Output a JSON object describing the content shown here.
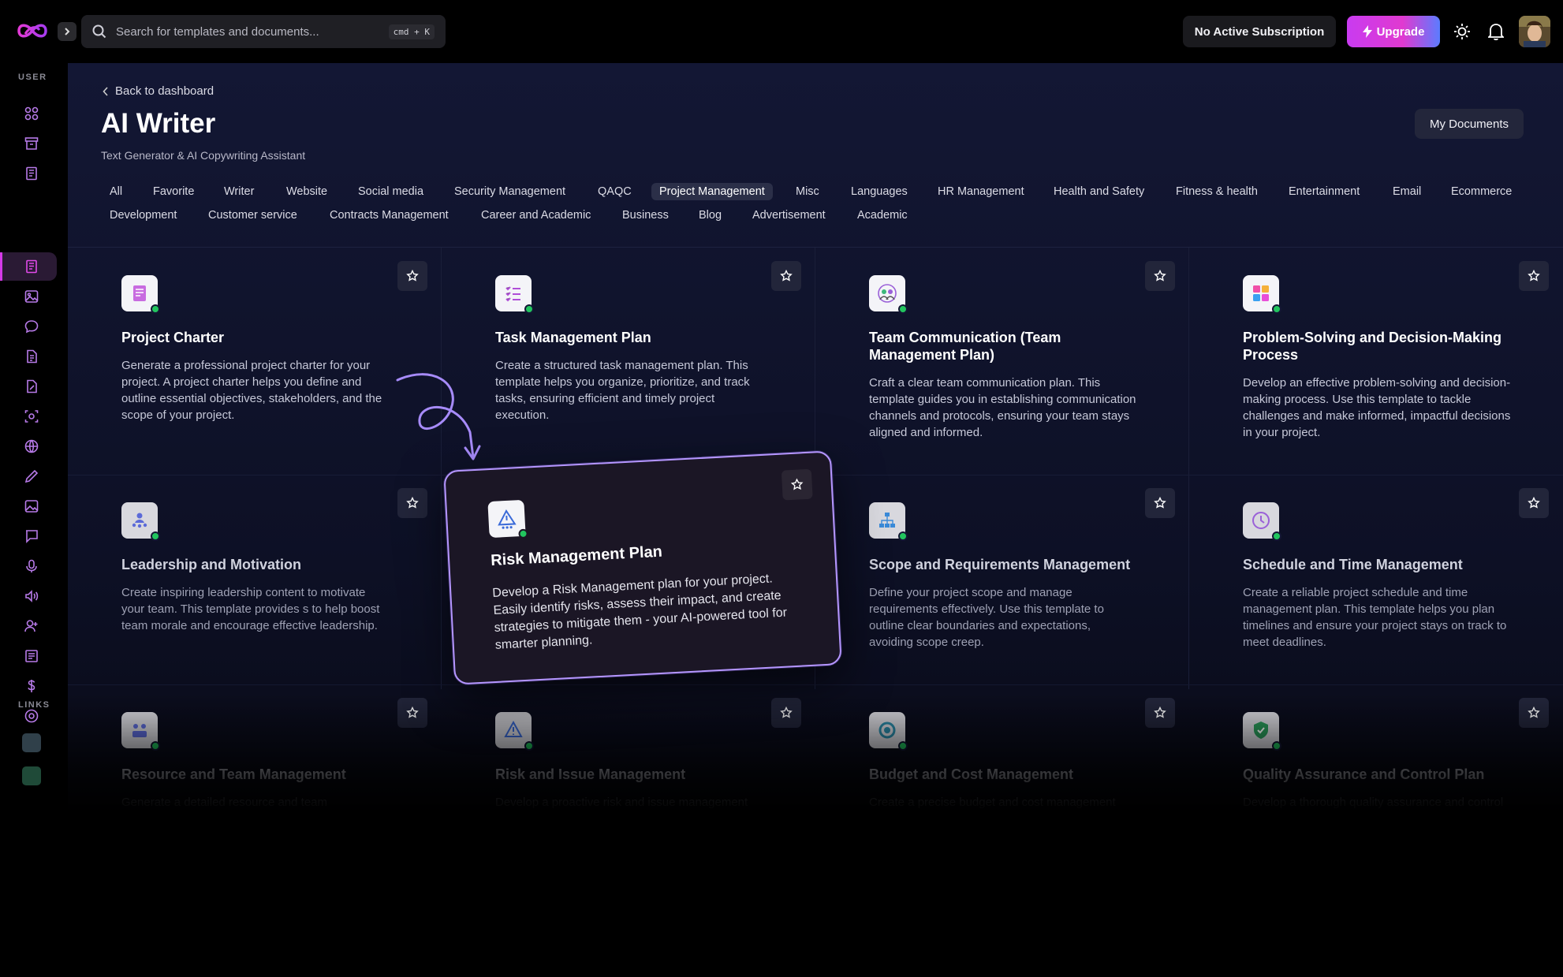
{
  "topbar": {
    "search_placeholder": "Search for templates and documents...",
    "search_shortcut": "cmd + K",
    "subscription_label": "No Active Subscription",
    "upgrade_label": "Upgrade"
  },
  "sidebar": {
    "user_section": "USER",
    "links_section": "LINKS",
    "items": [
      {
        "icon": "dashboard-grid-icon"
      },
      {
        "icon": "archive-box-icon"
      },
      {
        "icon": "document-list-icon"
      },
      {
        "icon": "ai-writer-icon",
        "active": true
      },
      {
        "icon": "image-icon"
      },
      {
        "icon": "chat-bubble-icon"
      },
      {
        "icon": "file-text-icon"
      },
      {
        "icon": "file-edit-icon"
      },
      {
        "icon": "scan-icon"
      },
      {
        "icon": "globe-icon"
      },
      {
        "icon": "pen-icon"
      },
      {
        "icon": "gallery-icon"
      },
      {
        "icon": "message-icon"
      },
      {
        "icon": "microphone-icon"
      },
      {
        "icon": "speaker-icon"
      },
      {
        "icon": "user-plus-icon"
      },
      {
        "icon": "clipboard-icon"
      },
      {
        "icon": "dollar-icon"
      },
      {
        "icon": "settings-icon"
      }
    ]
  },
  "header": {
    "back_label": "Back to dashboard",
    "title": "AI Writer",
    "subtitle": "Text Generator & AI Copywriting Assistant",
    "my_documents_label": "My Documents"
  },
  "categories": {
    "row1": [
      "All",
      "Favorite",
      "Writer",
      "Website",
      "Social media",
      "Security Management",
      "QAQC",
      "Project Management",
      "Misc",
      "Languages",
      "HR Management",
      "Health and Safety",
      "Fitness & health",
      "Entertainment",
      "Email",
      "Ecommerce"
    ],
    "row2": [
      "Development",
      "Customer service",
      "Contracts Management",
      "Career and Academic",
      "Business",
      "Blog",
      "Advertisement",
      "Academic"
    ],
    "active": "Project Management"
  },
  "cards": [
    {
      "title": "Project Charter",
      "desc": "Generate a professional project charter for your project. A project charter helps you define and outline essential objectives, stakeholders, and the scope of your project.",
      "icon": "project-charter-icon"
    },
    {
      "title": "Task Management Plan",
      "desc": "Create a structured task management plan. This template helps you organize, prioritize, and track tasks, ensuring efficient and timely project execution.",
      "icon": "task-list-icon"
    },
    {
      "title": "Team Communication (Team Management Plan)",
      "desc": "Craft a clear team communication plan. This template guides you in establishing communication channels and protocols, ensuring your team stays aligned and informed.",
      "icon": "team-communication-icon"
    },
    {
      "title": "Problem-Solving and Decision-Making Process",
      "desc": "Develop an effective problem-solving and decision-making process. Use this template to tackle challenges and make informed, impactful decisions in your project.",
      "icon": "puzzle-icon"
    },
    {
      "title": "Leadership and Motivation",
      "desc": "Create inspiring leadership content to motivate your team. This template provides s to help boost team morale and encourage effective leadership.",
      "icon": "leadership-icon"
    },
    {
      "title": "Scope and Requirements Management",
      "desc": "Define your project scope and manage requirements effectively. Use this template to outline clear boundaries and expectations, avoiding scope creep.",
      "icon": "hierarchy-icon"
    },
    {
      "title": "Schedule and Time Management",
      "desc": "Create a reliable project schedule and time management plan. This template helps you plan timelines and ensure your project stays on track to meet deadlines.",
      "icon": "clock-icon"
    },
    {
      "title": "Resource and Team Management",
      "desc": "Generate a detailed resource and team management plan. Use this template to allocate resources, manage team",
      "icon": "team-resources-icon"
    },
    {
      "title": "Risk and Issue Management",
      "desc": "Develop a proactive risk and issue management plan. This template helps you identify potential risks and issues",
      "icon": "risk-issue-icon"
    },
    {
      "title": "Budget and Cost Management",
      "desc": "Create a precise budget and cost management plan. This template helps you manage expenses, forecast costs",
      "icon": "budget-icon"
    },
    {
      "title": "Quality Assurance and Control Plan",
      "desc": "Develop a thorough quality assurance and control plan. Use this template to set up standards and processes",
      "icon": "shield-check-icon"
    }
  ],
  "floating_card": {
    "title": "Risk Management Plan",
    "desc": "Develop a Risk Management plan for your project. Easily identify risks, assess their impact, and create strategies to mitigate them - your AI-powered tool for smarter planning.",
    "icon": "risk-triangle-icon"
  },
  "colors": {
    "accent_magenta": "#d43ae8",
    "float_border": "#b596ff",
    "status_green": "#22c55e"
  }
}
